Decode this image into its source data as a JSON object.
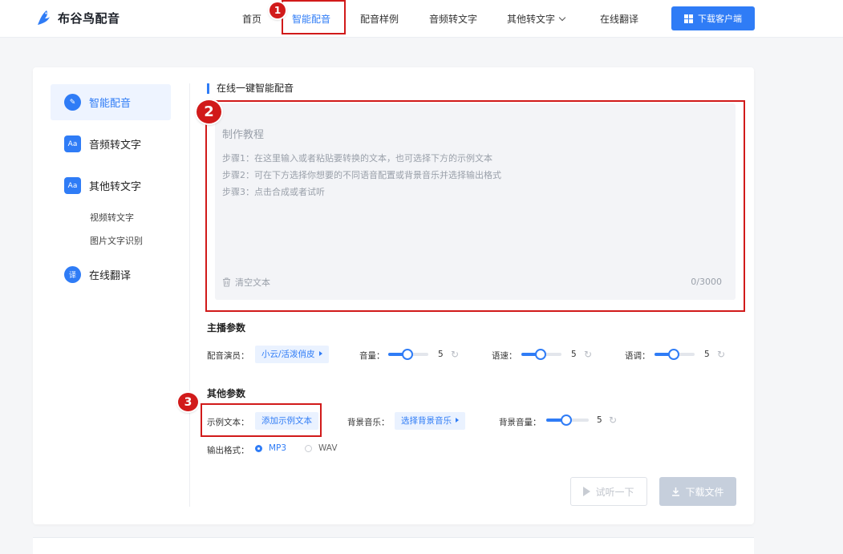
{
  "brand": {
    "name": "布谷鸟配音",
    "logo_icon": "bird-logo-icon"
  },
  "nav": {
    "items": [
      {
        "label": "首页",
        "active": false
      },
      {
        "label": "智能配音",
        "active": true
      },
      {
        "label": "配音样例",
        "active": false
      },
      {
        "label": "音频转文字",
        "active": false
      },
      {
        "label": "其他转文字",
        "active": false,
        "has_dropdown": true
      },
      {
        "label": "在线翻译",
        "active": false
      }
    ],
    "download_label": "下载客户端"
  },
  "annotations": {
    "n1": "1",
    "n2": "2",
    "n3": "3",
    "color": "#d11a1a"
  },
  "sidebar": {
    "items": [
      {
        "label": "智能配音",
        "icon": "smart-dubbing-icon",
        "active": true
      },
      {
        "label": "音频转文字",
        "icon": "audio-to-text-icon",
        "active": false
      },
      {
        "label": "其他转文字",
        "icon": "other-to-text-icon",
        "active": false
      }
    ],
    "subitems": [
      "视频转文字",
      "图片文字识别"
    ],
    "translate": {
      "label": "在线翻译",
      "icon": "translate-icon"
    }
  },
  "main": {
    "section_title": "在线一键智能配音",
    "editor": {
      "placeholder_title": "制作教程",
      "steps": [
        "步骤1：在这里输入或者粘贴要转换的文本，也可选择下方的示例文本",
        "步骤2：可在下方选择你想要的不同语音配置或背景音乐并选择输出格式",
        "步骤3：点击合成或者试听"
      ],
      "clear_label": "清空文本",
      "counter": "0/3000"
    },
    "anchor_params": {
      "title": "主播参数",
      "voice_label": "配音演员：",
      "voice_value": "小云/活泼俏皮",
      "volume_label": "音量：",
      "volume_value": "5",
      "speed_label": "语速：",
      "speed_value": "5",
      "pitch_label": "语调：",
      "pitch_value": "5",
      "slider_fraction": 0.45
    },
    "other_params": {
      "title": "其他参数",
      "sample_label": "示例文本：",
      "sample_value": "添加示例文本",
      "bgm_label": "背景音乐：",
      "bgm_value": "选择背景音乐",
      "bgm_volume_label": "背景音量：",
      "bgm_volume_value": "5",
      "format_label": "输出格式：",
      "formats": [
        {
          "label": "MP3",
          "selected": true
        },
        {
          "label": "WAV",
          "selected": false
        }
      ]
    },
    "actions": {
      "listen_label": "试听一下",
      "download_label": "下载文件"
    }
  },
  "colors": {
    "accent": "#2f7cf6",
    "annotation": "#d11a1a",
    "editor_bg": "#f3f4f7"
  }
}
